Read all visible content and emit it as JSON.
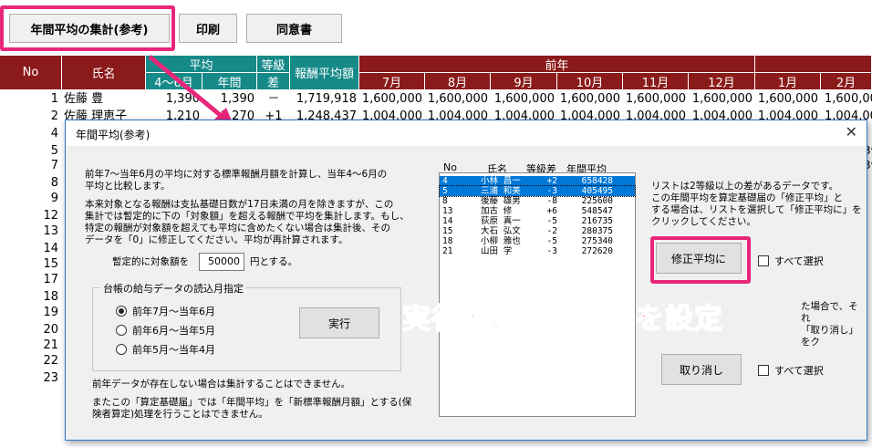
{
  "toolbar": {
    "annual_avg_button": "年間平均の集計(参考)",
    "print_button": "印刷",
    "consent_button": "同意書"
  },
  "sheet": {
    "headers": {
      "no": "No",
      "name": "氏名",
      "average": "平均",
      "avg_apr_jun": "4～6月",
      "avg_annual": "年間",
      "grade_diff_top": "等級",
      "grade_diff_bottom": "差",
      "reward_avg": "報酬平均額",
      "prev_year": "前年",
      "months": [
        "7月",
        "8月",
        "9月",
        "10月",
        "11月",
        "12月",
        "1月",
        "2月"
      ]
    },
    "rows": [
      {
        "no": "1",
        "name": "佐藤 豊",
        "avg46": "1,390",
        "annual": "1,390",
        "diff": "－",
        "reward": "1,719,918",
        "m": [
          "1,600,000",
          "1,600,000",
          "1,600,000",
          "1,600,000",
          "1,600,000",
          "1,600,000",
          "1,600,000",
          "1,600,00"
        ]
      },
      {
        "no": "2",
        "name": "佐藤 理恵子",
        "avg46": "1,210",
        "annual": "1,270",
        "diff": "+1",
        "reward": "1,248,437",
        "m": [
          "1,004,000",
          "1,004,000",
          "1,004,000",
          "1,004,000",
          "1,004,000",
          "1,004,000",
          "1,004,000",
          "1,004,00"
        ]
      }
    ],
    "row_numbers": [
      "4",
      "5",
      "7",
      "8",
      "9",
      "12",
      "13",
      "14",
      "15",
      "17",
      "18",
      "19",
      "20",
      "21",
      "22",
      "23"
    ],
    "right_edge_digits": [
      "39",
      "39",
      "00",
      "00",
      "00",
      "00",
      "00",
      "00",
      "00",
      "00",
      "00",
      "00"
    ]
  },
  "dialog": {
    "title": "年間平均(参考)",
    "close": "✕",
    "desc1_line1": "前年7～当年6月の平均に対する標準報酬月額を計算し、当年4～6月の",
    "desc1_line2": "平均と比較します。",
    "desc2_line1": "本来対象となる報酬は支払基礎日数が17日未満の月を除きますが、この",
    "desc2_line2": "集計では暫定的に下の「対象額」を超える報酬で平均を集計します。もし、",
    "desc2_line3": "特定の報酬が対象額を超えても平均に含めたくない場合は集計後、その",
    "desc2_line4": "データを「0」に修正してください。平均が再計算されます。",
    "threshold_label": "暫定的に対象額を",
    "threshold_value": "50000",
    "threshold_suffix": "円とする。",
    "group_label": "台帳の給与データの読込月指定",
    "radio_options": [
      "前年7月～当年6月",
      "前年6月～当年5月",
      "前年5月～当年4月"
    ],
    "selected_radio": 0,
    "run_button": "実行",
    "note1": "前年データが存在しない場合は集計することはできません。",
    "note2_line1": "またこの「算定基礎届」では「年間平均」を「新標準報酬月額」とする(保",
    "note2_line2": "険者算定)処理を行うことはできません。",
    "list_headers": {
      "no": "No",
      "name": "氏名",
      "diff": "等級差",
      "avg": "年間平均"
    },
    "list_rows": [
      {
        "no": "4",
        "name": "小林 昌一",
        "diff": "+2",
        "avg": "658428"
      },
      {
        "no": "5",
        "name": "三浦 和美",
        "diff": "-3",
        "avg": "405495"
      },
      {
        "no": "8",
        "name": "後藤 雄男",
        "diff": "-8",
        "avg": "225600"
      },
      {
        "no": "13",
        "name": "加古 修",
        "diff": "+6",
        "avg": "548547"
      },
      {
        "no": "14",
        "name": "荻原 真一",
        "diff": "-5",
        "avg": "216735"
      },
      {
        "no": "15",
        "name": "大石 弘文",
        "diff": "-2",
        "avg": "280375"
      },
      {
        "no": "18",
        "name": "小柳 雅也",
        "diff": "-5",
        "avg": "275340"
      },
      {
        "no": "21",
        "name": "山田 学",
        "diff": "-3",
        "avg": "272620"
      }
    ],
    "right_text1_line1": "リストは2等級以上の差があるデータです。",
    "right_text1_line2": "この年間平均を算定基礎届の「修正平均」と",
    "right_text1_line3": "する場合は、リストを選択して「修正平均に」を",
    "right_text1_line4": "クリックしてください。",
    "apply_button": "修正平均に",
    "select_all_1": "すべて選択",
    "right_text2_line1_end": "た場合で、それ",
    "right_text2_line2_end": "「取り消し」をク",
    "cancel_button": "取り消し",
    "select_all_2": "すべて選択"
  },
  "annotation": {
    "overlay_text": "実行後、修正平均を設定"
  },
  "colors": {
    "header_maroon": "#8b1a1a",
    "header_teal": "#168a88",
    "highlight_pink": "#e8277a",
    "selection_blue": "#0078d7"
  }
}
